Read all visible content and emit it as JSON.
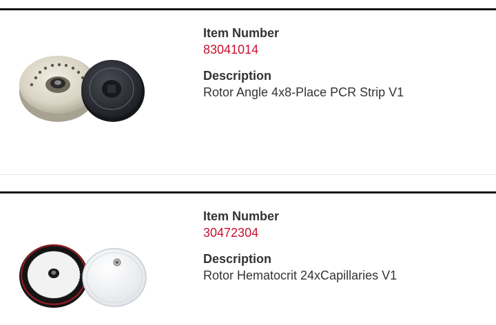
{
  "colors": {
    "link": "#c8102e",
    "divider": "#111111",
    "text": "#333333"
  },
  "products": [
    {
      "item_number_label": "Item Number",
      "item_number": "83041014",
      "description_label": "Description",
      "description": "Rotor Angle 4x8-Place PCR Strip V1",
      "image_icon": "rotor-angle-image"
    },
    {
      "item_number_label": "Item Number",
      "item_number": "30472304",
      "description_label": "Description",
      "description": "Rotor Hematocrit 24xCapillaries V1",
      "image_icon": "rotor-hematocrit-image"
    }
  ]
}
